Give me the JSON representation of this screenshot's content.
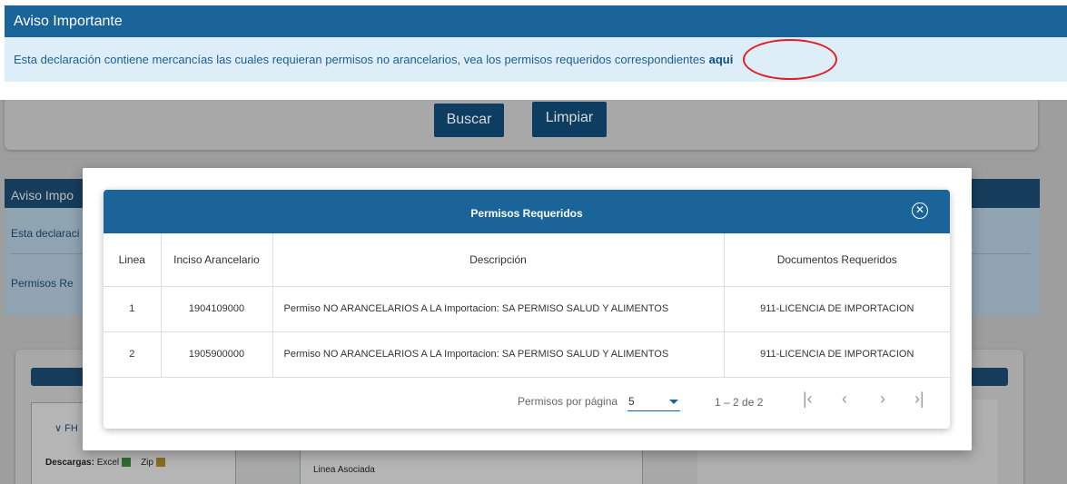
{
  "notice": {
    "title": "Aviso Importante",
    "message": "Esta declaración contiene mercancías las cuales requieran permisos no arancelarios, vea los permisos requeridos correspondientes",
    "link": "aqui"
  },
  "background": {
    "search_button": "Buscar",
    "clear_button": "Limpiar",
    "notice_title": "Aviso Impo",
    "notice_text": "Esta declaraci",
    "permits_link": "Permisos Re",
    "section_label": "FH",
    "downloads_label": "Descargas:",
    "excel_label": "Excel",
    "zip_label": "Zip",
    "linea_asociada": "Linea Asociada"
  },
  "modal": {
    "title": "Permisos Requeridos",
    "columns": [
      "Linea",
      "Inciso Arancelario",
      "Descripción",
      "Documentos Requeridos"
    ],
    "rows": [
      {
        "linea": "1",
        "inciso": "1904109000",
        "descripcion": "Permiso NO ARANCELARIOS A LA Importacion: SA PERMISO SALUD Y ALIMENTOS",
        "documentos": "911-LICENCIA DE IMPORTACION"
      },
      {
        "linea": "2",
        "inciso": "1905900000",
        "descripcion": "Permiso NO ARANCELARIOS A LA Importacion: SA PERMISO SALUD Y ALIMENTOS",
        "documentos": "911-LICENCIA DE IMPORTACION"
      }
    ],
    "paginator": {
      "label": "Permisos por página",
      "page_size": "5",
      "range": "1 – 2 de 2"
    }
  },
  "colors": {
    "header_blue": "#1a6499",
    "notice_bg": "#deeef8",
    "highlight_red": "#e01f1f"
  }
}
